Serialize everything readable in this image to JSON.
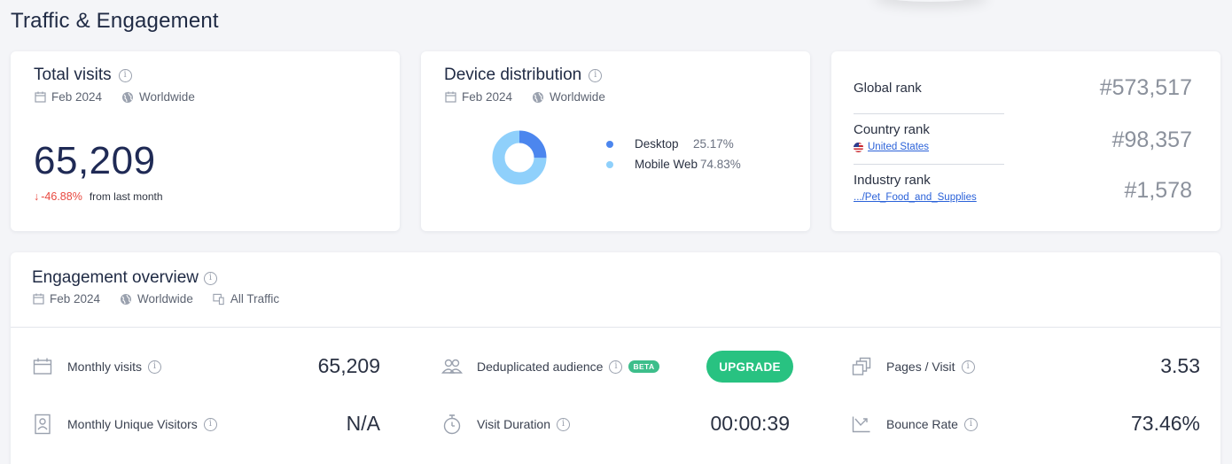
{
  "page": {
    "title": "Traffic & Engagement"
  },
  "total_visits": {
    "title": "Total visits",
    "date": "Feb 2024",
    "region": "Worldwide",
    "value": "65,209",
    "change": "-46.88%",
    "change_text": "from last month",
    "colors": {
      "negative": "#e8483f"
    }
  },
  "device": {
    "title": "Device distribution",
    "date": "Feb 2024",
    "region": "Worldwide",
    "items": [
      {
        "name": "Desktop",
        "pct": "25.17%",
        "value": 25.17,
        "color": "#4c86ee"
      },
      {
        "name": "Mobile Web",
        "pct": "74.83%",
        "value": 74.83,
        "color": "#8fd0fb"
      }
    ]
  },
  "ranks": {
    "global": {
      "label": "Global rank",
      "value": "#573,517"
    },
    "country": {
      "label": "Country rank",
      "link": "United States",
      "value": "#98,357"
    },
    "industry": {
      "label": "Industry rank",
      "link": ".../Pet_Food_and_Supplies",
      "value": "#1,578"
    }
  },
  "engagement": {
    "title": "Engagement overview",
    "date": "Feb 2024",
    "region": "Worldwide",
    "traffic": "All Traffic",
    "metrics": {
      "monthly_visits": {
        "label": "Monthly visits",
        "value": "65,209"
      },
      "unique_visitors": {
        "label": "Monthly Unique Visitors",
        "value": "N/A"
      },
      "dedup_audience": {
        "label": "Deduplicated audience",
        "badge": "BETA"
      },
      "visit_duration": {
        "label": "Visit Duration",
        "value": "00:00:39"
      },
      "pages_visit": {
        "label": "Pages / Visit",
        "value": "3.53"
      },
      "bounce_rate": {
        "label": "Bounce Rate",
        "value": "73.46%"
      }
    },
    "upgrade_label": "UPGRADE",
    "colors": {
      "upgrade": "#28c281",
      "beta": "#3dbe8b"
    }
  }
}
